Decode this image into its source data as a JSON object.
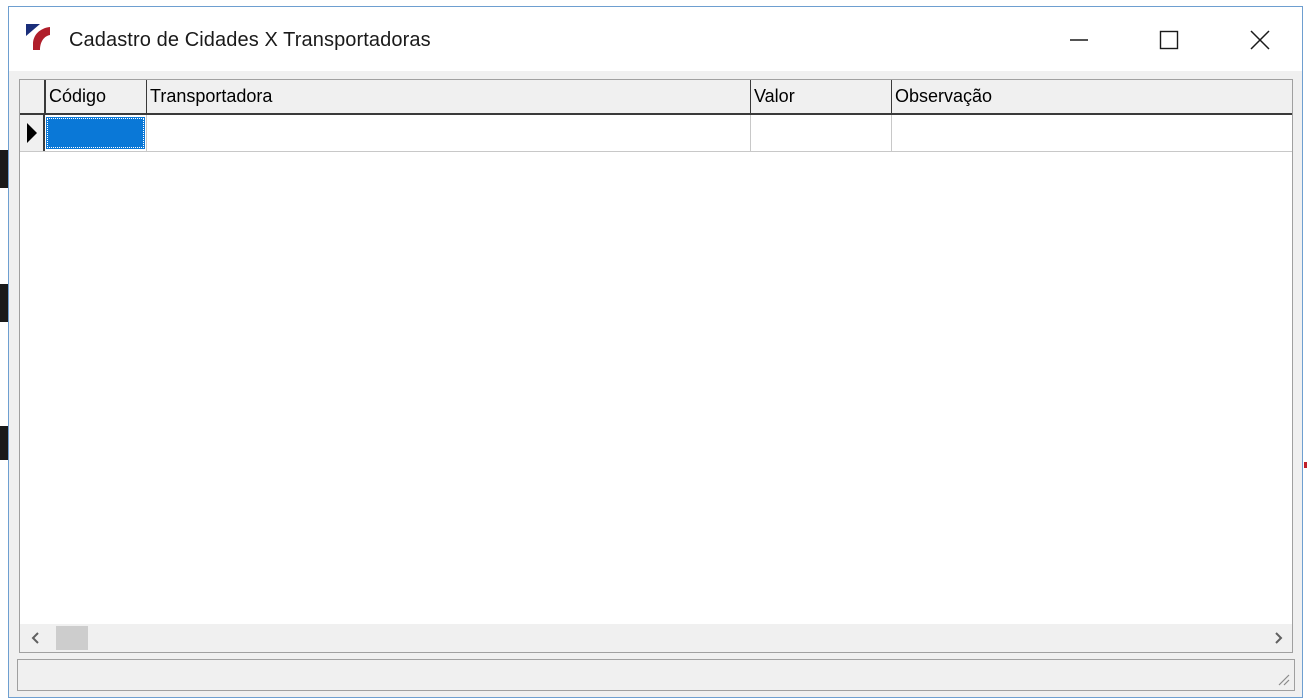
{
  "window": {
    "title": "Cadastro de Cidades X Transportadoras",
    "controls": [
      "minimize-icon",
      "maximize-icon",
      "close-icon"
    ]
  },
  "grid": {
    "columns": [
      {
        "key": "codigo",
        "label": "Código"
      },
      {
        "key": "transportadora",
        "label": "Transportadora"
      },
      {
        "key": "valor",
        "label": "Valor"
      },
      {
        "key": "observacao",
        "label": "Observação"
      }
    ],
    "rows": [
      {
        "codigo": "",
        "transportadora": "",
        "valor": "",
        "observacao": ""
      }
    ],
    "selection_color": "#0a78d7"
  },
  "scrollbar": {
    "left_icon": "chevron-left-icon",
    "right_icon": "chevron-right-icon"
  },
  "statusbar": {
    "text": ""
  },
  "colors": {
    "window_border": "#6e9fd0",
    "logo_blue": "#1a2e7a",
    "logo_red": "#b01e2a"
  }
}
